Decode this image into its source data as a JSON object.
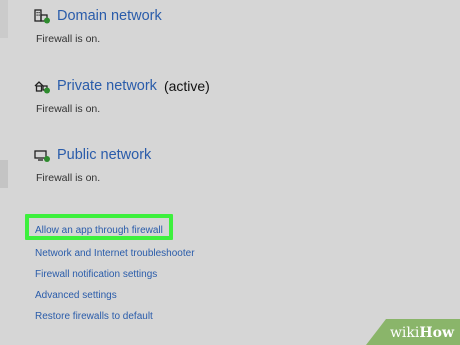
{
  "networks": [
    {
      "name": "Domain network",
      "status": "Firewall is on.",
      "icon": "domain-network-icon"
    },
    {
      "name": "Private network",
      "badge": "(active)",
      "status": "Firewall is on.",
      "icon": "private-network-icon"
    },
    {
      "name": "Public network",
      "status": "Firewall is on.",
      "icon": "public-network-icon"
    }
  ],
  "links": [
    "Allow an app through firewall",
    "Network and Internet troubleshooter",
    "Firewall notification settings",
    "Advanced settings",
    "Restore firewalls to default"
  ],
  "watermark": {
    "part1": "wiki",
    "part2": "How"
  },
  "colors": {
    "link": "#2a5caa",
    "highlight": "#3df03d",
    "background": "#d6d6d6",
    "watermark_bg": "#8ab56a",
    "status_dot": "#2e8b2e"
  }
}
